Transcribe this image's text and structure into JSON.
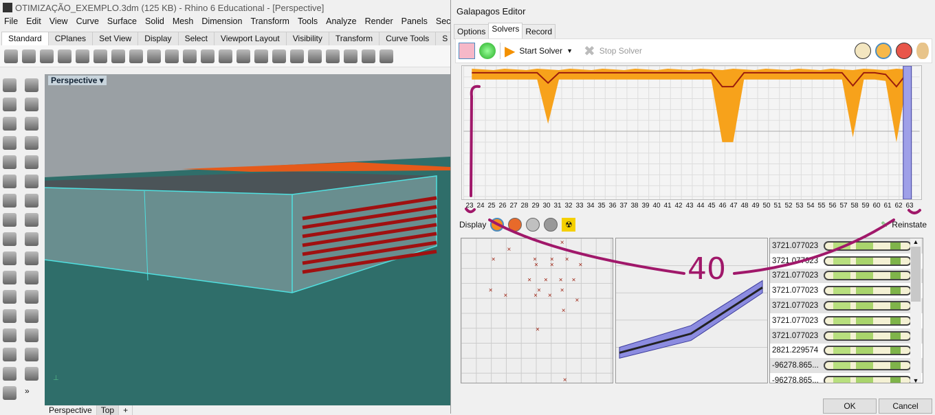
{
  "rhino": {
    "title": "OTIMIZAÇÃO_EXEMPLO.3dm (125 KB) - Rhino 6 Educational - [Perspective]",
    "menu": [
      "File",
      "Edit",
      "View",
      "Curve",
      "Surface",
      "Solid",
      "Mesh",
      "Dimension",
      "Transform",
      "Tools",
      "Analyze",
      "Render",
      "Panels",
      "Sectio"
    ],
    "tabs": [
      "Standard",
      "CPlanes",
      "Set View",
      "Display",
      "Select",
      "Viewport Layout",
      "Visibility",
      "Transform",
      "Curve Tools",
      "S"
    ],
    "viewport_label": "Perspective",
    "viewport_tabs": [
      "Perspective",
      "Top",
      "+"
    ],
    "more_label": "»"
  },
  "galapagos": {
    "title": "Galapagos Editor",
    "tabs": [
      "Options",
      "Solvers",
      "Record"
    ],
    "start_solver": "Start Solver",
    "stop_solver": "Stop Solver",
    "generations": [
      "23",
      "24",
      "25",
      "26",
      "27",
      "28",
      "29",
      "30",
      "31",
      "32",
      "33",
      "34",
      "35",
      "36",
      "37",
      "38",
      "39",
      "40",
      "41",
      "42",
      "43",
      "44",
      "45",
      "46",
      "47",
      "48",
      "49",
      "50",
      "51",
      "52",
      "53",
      "54",
      "55",
      "56",
      "57",
      "58",
      "59",
      "60",
      "61",
      "62",
      "63"
    ],
    "display_label": "Display",
    "reinstate_label": "Reinstate",
    "genomes": [
      "3721.077023",
      "3721.077023",
      "3721.077023",
      "3721.077023",
      "3721.077023",
      "3721.077023",
      "3721.077023",
      "2821.229574",
      "-96278.865...",
      "-96278.865..."
    ],
    "ok": "OK",
    "cancel": "Cancel"
  },
  "annotation": {
    "text": "40",
    "color": "#a0186a"
  },
  "colors": {
    "viewport_sky": "#9aa0a4",
    "viewport_ground": "#2f6e6a",
    "fitness_orange": "#f7a21b",
    "fitness_line": "#9b1d0c",
    "selection": "#9fa0e8"
  }
}
